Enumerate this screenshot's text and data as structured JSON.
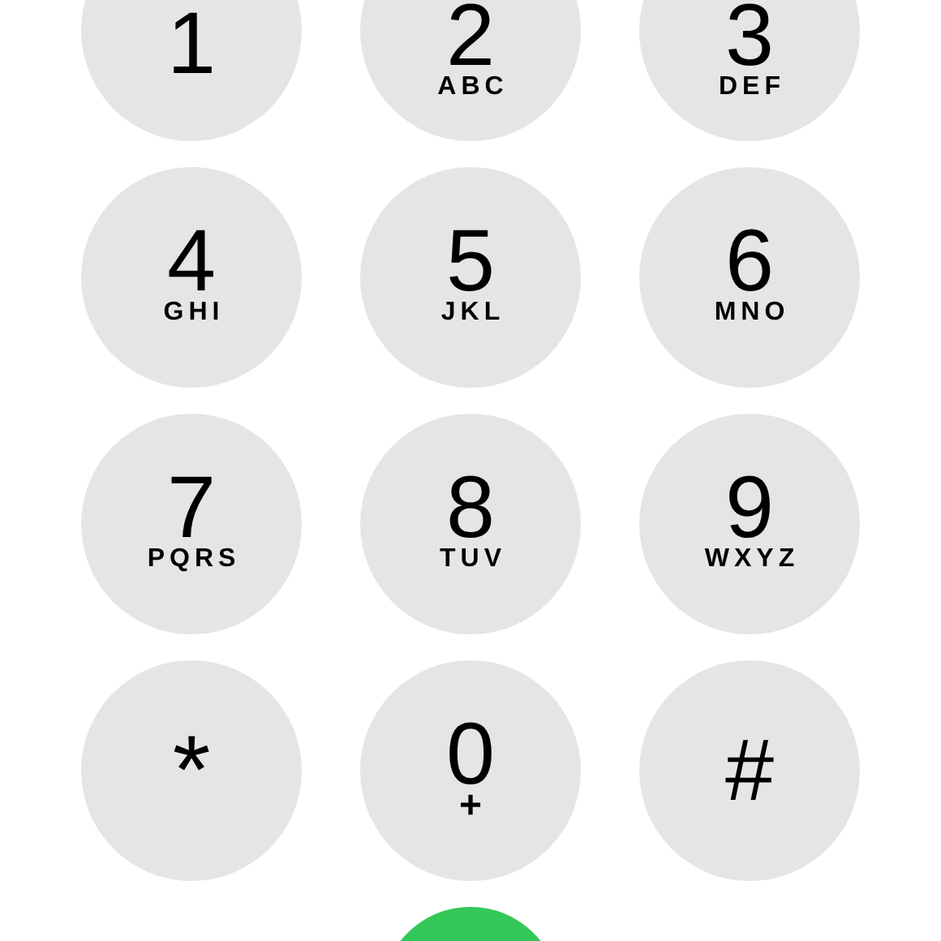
{
  "keypad": [
    {
      "digit": "1"
    },
    {
      "digit": "2",
      "letters": "ABC"
    },
    {
      "digit": "3",
      "letters": "DEF"
    },
    {
      "digit": "4",
      "letters": "GHI"
    },
    {
      "digit": "5",
      "letters": "JKL"
    },
    {
      "digit": "6",
      "letters": "MNO"
    },
    {
      "digit": "7",
      "letters": "PQRS"
    },
    {
      "digit": "8",
      "letters": "TUV"
    },
    {
      "digit": "9",
      "letters": "WXYZ"
    },
    {
      "digit": "*"
    },
    {
      "digit": "0",
      "letters": "+"
    },
    {
      "digit": "#"
    }
  ]
}
